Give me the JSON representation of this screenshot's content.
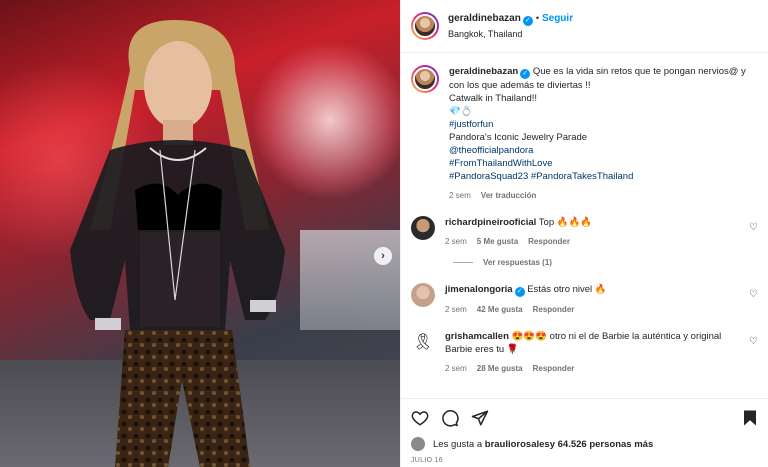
{
  "post": {
    "username": "geraldinebazan",
    "dot": "•",
    "follow_label": "Seguir",
    "location": "Bangkok, Thailand"
  },
  "caption": {
    "username": "geraldinebazan",
    "text_line1": "Que es la vida sin retos que te pongan nervios@ y con los que además te diviertas !!",
    "text_line2": "Catwalk in Thailand!!",
    "emojis": "💎💍",
    "hashtag_justforfun": "#justforfun",
    "text_line3": "Pandora's Iconic Jewelry Parade",
    "mention": "@theofficialpandora",
    "hashtag_1": "#FromThailandWithLove",
    "hashtag_2": "#PandoraSquad23",
    "hashtag_3": "#PandoraTakesThailand",
    "time": "2 sem",
    "translate_label": "Ver traducción"
  },
  "comments": [
    {
      "username": "richardpineirooficial",
      "text": "Top 🔥🔥🔥",
      "time": "2 sem",
      "likes": "5 Me gusta",
      "reply_label": "Responder",
      "view_replies": "Ver respuestas (1)"
    },
    {
      "username": "jimenalongoria",
      "text": "Estás otro nivel 🔥",
      "time": "2 sem",
      "likes": "42 Me gusta",
      "reply_label": "Responder"
    },
    {
      "username": "grishamcallen",
      "text": "😍😍😍 otro ni el de Barbie la auténtica y original Barbie eres tu 🌹",
      "time": "2 sem",
      "likes": "28 Me gusta",
      "reply_label": "Responder"
    }
  ],
  "footer": {
    "likes_prefix": "Les gusta a ",
    "likes_user": "brauliorosales",
    "likes_suffix": " y 64.526 personas más",
    "date": "JULIO 16"
  },
  "icons": {
    "heart": "heart-icon",
    "comment": "comment-icon",
    "share": "share-icon",
    "save": "bookmark-icon",
    "next": "chevron-right-icon"
  },
  "colors": {
    "accent": "#0095f6",
    "link": "#00376b",
    "meta": "#737373"
  }
}
